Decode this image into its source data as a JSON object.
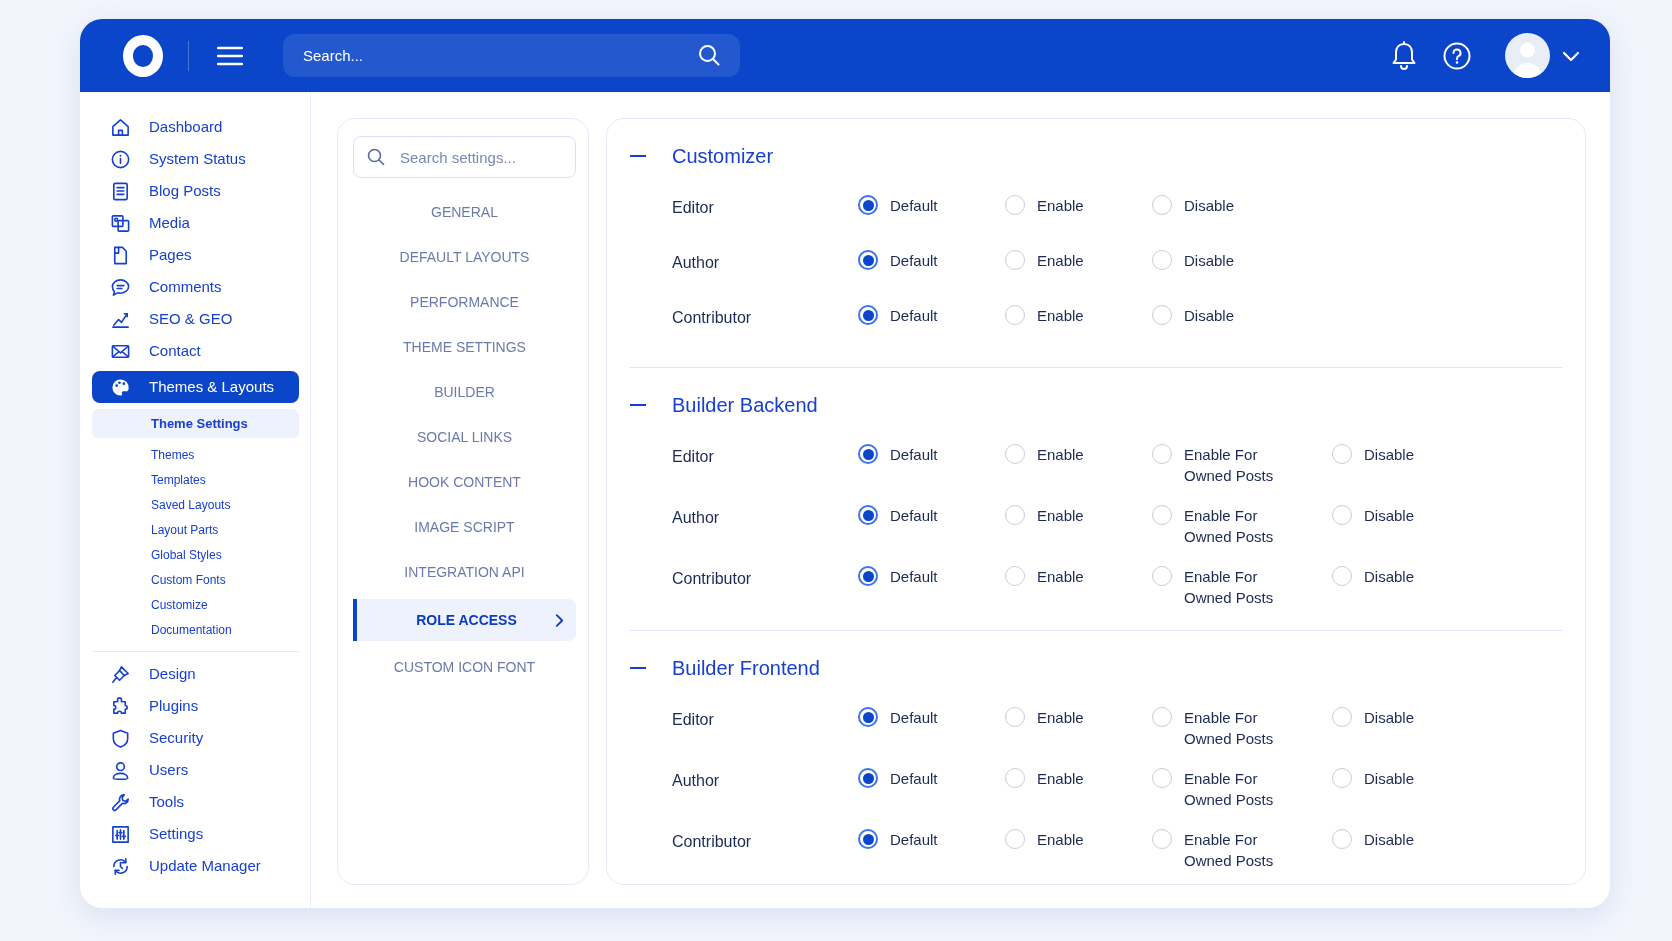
{
  "header": {
    "search": {
      "placeholder": "Search..."
    }
  },
  "sidebar": {
    "items": [
      {
        "label": "Dashboard",
        "selected": false
      },
      {
        "label": "System Status",
        "selected": false
      },
      {
        "label": "Blog Posts",
        "selected": false
      },
      {
        "label": "Media",
        "selected": false
      },
      {
        "label": "Pages",
        "selected": false
      },
      {
        "label": "Comments",
        "selected": false
      },
      {
        "label": "SEO & GEO",
        "selected": false
      },
      {
        "label": "Contact",
        "selected": false
      },
      {
        "label": "Themes & Layouts",
        "selected": true,
        "children": [
          {
            "label": "Theme Settings",
            "selected": true
          },
          {
            "label": "Themes",
            "selected": false
          },
          {
            "label": "Templates",
            "selected": false
          },
          {
            "label": "Saved Layouts",
            "selected": false
          },
          {
            "label": "Layout Parts",
            "selected": false
          },
          {
            "label": "Global Styles",
            "selected": false
          },
          {
            "label": "Custom Fonts",
            "selected": false
          },
          {
            "label": "Customize",
            "selected": false
          },
          {
            "label": "Documentation",
            "selected": false
          }
        ]
      },
      {
        "label": "Design",
        "selected": false
      },
      {
        "label": "Plugins",
        "selected": false
      },
      {
        "label": "Security",
        "selected": false
      },
      {
        "label": "Users",
        "selected": false
      },
      {
        "label": "Tools",
        "selected": false
      },
      {
        "label": "Settings",
        "selected": false
      },
      {
        "label": "Update Manager",
        "selected": false
      }
    ]
  },
  "settings_menu": {
    "search": {
      "placeholder": "Search settings..."
    },
    "items": [
      {
        "label": "GENERAL",
        "selected": false
      },
      {
        "label": "DEFAULT LAYOUTS",
        "selected": false
      },
      {
        "label": "PERFORMANCE",
        "selected": false
      },
      {
        "label": "THEME SETTINGS",
        "selected": false
      },
      {
        "label": "BUILDER",
        "selected": false
      },
      {
        "label": "SOCIAL LINKS",
        "selected": false
      },
      {
        "label": "HOOK CONTENT",
        "selected": false
      },
      {
        "label": "IMAGE SCRIPT",
        "selected": false
      },
      {
        "label": "INTEGRATION API",
        "selected": false
      },
      {
        "label": "ROLE ACCESS",
        "selected": true
      },
      {
        "label": "CUSTOM ICON FONT",
        "selected": false
      }
    ]
  },
  "sections": [
    {
      "title": "Customizer",
      "expanded": true,
      "rows": [
        {
          "role": "Editor",
          "options": [
            {
              "label": "Default",
              "selected": true
            },
            {
              "label": "Enable",
              "selected": false
            },
            {
              "label": "Disable",
              "selected": false
            }
          ]
        },
        {
          "role": "Author",
          "options": [
            {
              "label": "Default",
              "selected": true
            },
            {
              "label": "Enable",
              "selected": false
            },
            {
              "label": "Disable",
              "selected": false
            }
          ]
        },
        {
          "role": "Contributor",
          "options": [
            {
              "label": "Default",
              "selected": true
            },
            {
              "label": "Enable",
              "selected": false
            },
            {
              "label": "Disable",
              "selected": false
            }
          ]
        }
      ]
    },
    {
      "title": "Builder Backend",
      "expanded": true,
      "rows": [
        {
          "role": "Editor",
          "options": [
            {
              "label": "Default",
              "selected": true
            },
            {
              "label": "Enable",
              "selected": false
            },
            {
              "label": "Enable For Owned Posts",
              "selected": false
            },
            {
              "label": "Disable",
              "selected": false
            }
          ]
        },
        {
          "role": "Author",
          "options": [
            {
              "label": "Default",
              "selected": true
            },
            {
              "label": "Enable",
              "selected": false
            },
            {
              "label": "Enable For Owned Posts",
              "selected": false
            },
            {
              "label": "Disable",
              "selected": false
            }
          ]
        },
        {
          "role": "Contributor",
          "options": [
            {
              "label": "Default",
              "selected": true
            },
            {
              "label": "Enable",
              "selected": false
            },
            {
              "label": "Enable For Owned Posts",
              "selected": false
            },
            {
              "label": "Disable",
              "selected": false
            }
          ]
        }
      ]
    },
    {
      "title": "Builder Frontend",
      "expanded": true,
      "rows": [
        {
          "role": "Editor",
          "options": [
            {
              "label": "Default",
              "selected": true
            },
            {
              "label": "Enable",
              "selected": false
            },
            {
              "label": "Enable For Owned Posts",
              "selected": false
            },
            {
              "label": "Disable",
              "selected": false
            }
          ]
        },
        {
          "role": "Author",
          "options": [
            {
              "label": "Default",
              "selected": true
            },
            {
              "label": "Enable",
              "selected": false
            },
            {
              "label": "Enable For Owned Posts",
              "selected": false
            },
            {
              "label": "Disable",
              "selected": false
            }
          ]
        },
        {
          "role": "Contributor",
          "options": [
            {
              "label": "Default",
              "selected": true
            },
            {
              "label": "Enable",
              "selected": false
            },
            {
              "label": "Enable For Owned Posts",
              "selected": false
            },
            {
              "label": "Disable",
              "selected": false
            }
          ]
        }
      ]
    }
  ]
}
